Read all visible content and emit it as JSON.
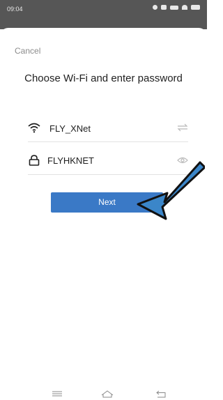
{
  "status_bar": {
    "time": "09:04"
  },
  "sheet": {
    "cancel_label": "Cancel",
    "title": "Choose Wi-Fi and enter password",
    "wifi_name": "FLY_XNet",
    "password_value": "FLYHKNET",
    "next_label": "Next"
  },
  "colors": {
    "accent": "#3a79c6",
    "arrow": "#3b86c9"
  },
  "icons": {
    "wifi": "wifi-icon",
    "lock": "lock-icon",
    "switch": "switch-icon",
    "eye": "eye-icon",
    "menu": "menu-icon",
    "home": "home-icon",
    "back": "back-icon"
  }
}
